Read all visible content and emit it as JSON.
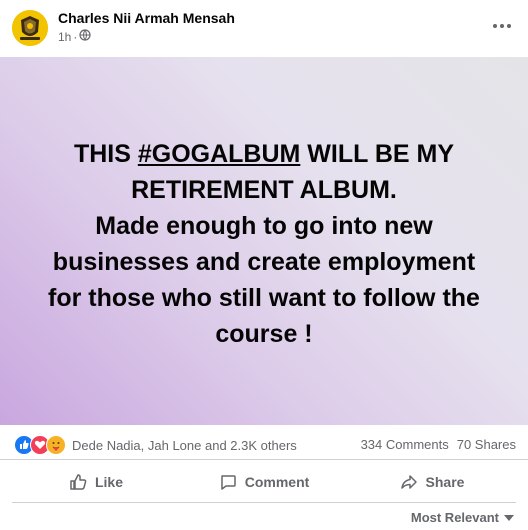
{
  "post": {
    "author": "Charles Nii Armah Mensah",
    "time": "1h",
    "separator": "·",
    "privacy_icon": "globe-icon",
    "more_icon": "more-horizontal-icon"
  },
  "body": {
    "line1_pre": "THIS ",
    "line1_hashtag": "#GOGALBUM",
    "line1_post": " WILL BE MY",
    "line2": "RETIREMENT ALBUM.",
    "line3": "Made enough to go into new",
    "line4": "businesses and create employment",
    "line5": "for those who still want to follow the",
    "line6": "course !",
    "background_colors": [
      "#c9a7df",
      "#e4e4e8"
    ]
  },
  "reactions": {
    "icons": [
      "like-icon",
      "love-icon",
      "care-icon"
    ],
    "names": "Dede Nadia, Jah Lone and 2.3K others",
    "comments": "334 Comments",
    "shares": "70 Shares"
  },
  "actions": {
    "like": "Like",
    "comment": "Comment",
    "share": "Share"
  },
  "comments_sort": {
    "label": "Most Relevant"
  },
  "colors": {
    "like_blue": "#1877f2",
    "love_red": "#f33e58",
    "care_yellow": "#f7b125",
    "secondary_text": "#65676b"
  }
}
